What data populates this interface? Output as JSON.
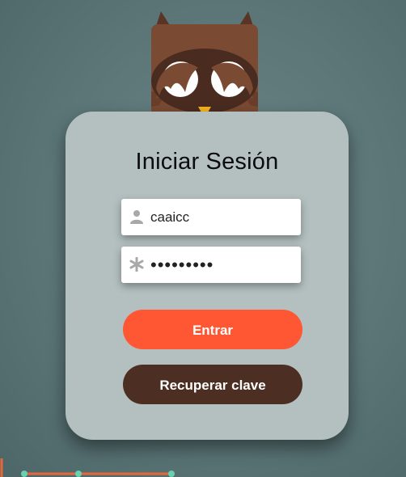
{
  "login": {
    "title": "Iniciar Sesión",
    "username_value": "caaicc",
    "password_value": "caaiccxyz",
    "login_button": "Entrar",
    "recover_button": "Recuperar clave"
  },
  "icons": {
    "user": "user-icon",
    "password": "asterisk-icon",
    "mascot": "owl-icon"
  },
  "colors": {
    "background": "#5c7678",
    "card": "#b4c0c0",
    "login_button": "#ff5733",
    "recover_button": "#4d2e22",
    "owl_body": "#7a4a33"
  }
}
